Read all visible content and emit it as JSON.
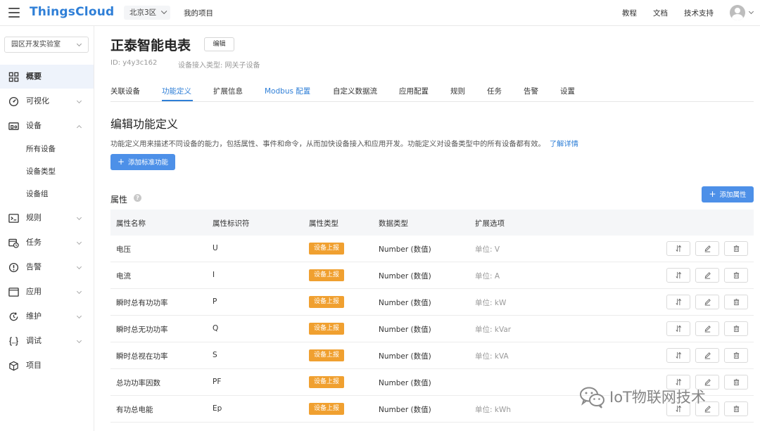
{
  "topbar": {
    "logo": "ThingsCloud",
    "region": "北京3区",
    "project": "我的项目",
    "links": [
      "教程",
      "文档",
      "技术支持"
    ]
  },
  "sidebar": {
    "lab_select": "园区开发实验室",
    "items": [
      {
        "label": "概要",
        "icon": "grid-icon",
        "active": true
      },
      {
        "label": "可视化",
        "icon": "gauge-icon"
      },
      {
        "label": "设备",
        "icon": "device-icon",
        "expanded": true
      },
      {
        "label": "规则",
        "icon": "terminal-icon"
      },
      {
        "label": "任务",
        "icon": "calendar-clock-icon"
      },
      {
        "label": "告警",
        "icon": "alert-icon"
      },
      {
        "label": "应用",
        "icon": "window-icon"
      },
      {
        "label": "维护",
        "icon": "refresh-clock-icon"
      },
      {
        "label": "调试",
        "icon": "braces-icon"
      },
      {
        "label": "项目",
        "icon": "cube-icon"
      }
    ],
    "sub_items": [
      "所有设备",
      "设备类型",
      "设备组"
    ]
  },
  "header": {
    "title": "正泰智能电表",
    "edit_label": "编辑",
    "id_text": "ID: y4y3c162",
    "access_type": "设备接入类型: 网关子设备"
  },
  "tabs": [
    {
      "label": "关联设备"
    },
    {
      "label": "功能定义",
      "active": true
    },
    {
      "label": "扩展信息"
    },
    {
      "label": "Modbus 配置"
    },
    {
      "label": "自定义数据流"
    },
    {
      "label": "应用配置"
    },
    {
      "label": "规则"
    },
    {
      "label": "任务"
    },
    {
      "label": "告警"
    },
    {
      "label": "设置"
    }
  ],
  "section": {
    "title": "编辑功能定义",
    "description": "功能定义用来描述不同设备的能力，包括属性、事件和命令，从而加快设备接入和应用开发。功能定义对设备类型中的所有设备都有效。",
    "more_link": "了解详情",
    "add_standard_label": "添加标准功能",
    "attr_title": "属性",
    "add_attr_label": "添加属性"
  },
  "table": {
    "columns": [
      "属性名称",
      "属性标识符",
      "属性类型",
      "数据类型",
      "扩展选项"
    ],
    "rows": [
      {
        "name": "电压",
        "id": "U",
        "type": "设备上报",
        "dtype": "Number (数值)",
        "unit": "单位: V"
      },
      {
        "name": "电流",
        "id": "I",
        "type": "设备上报",
        "dtype": "Number (数值)",
        "unit": "单位: A"
      },
      {
        "name": "瞬时总有功功率",
        "id": "P",
        "type": "设备上报",
        "dtype": "Number (数值)",
        "unit": "单位: kW"
      },
      {
        "name": "瞬时总无功功率",
        "id": "Q",
        "type": "设备上报",
        "dtype": "Number (数值)",
        "unit": "单位: kVar"
      },
      {
        "name": "瞬时总视在功率",
        "id": "S",
        "type": "设备上报",
        "dtype": "Number (数值)",
        "unit": "单位: kVA"
      },
      {
        "name": "总功功率因数",
        "id": "PF",
        "type": "设备上报",
        "dtype": "Number (数值)",
        "unit": ""
      },
      {
        "name": "有功总电能",
        "id": "Ep",
        "type": "设备上报",
        "dtype": "Number (数值)",
        "unit": "单位: kWh"
      }
    ]
  },
  "watermark": {
    "text": "IoT物联网技术"
  },
  "colors": {
    "brand": "#2f7fd7",
    "primary_button": "#4d90e8",
    "badge": "#f0a030"
  }
}
